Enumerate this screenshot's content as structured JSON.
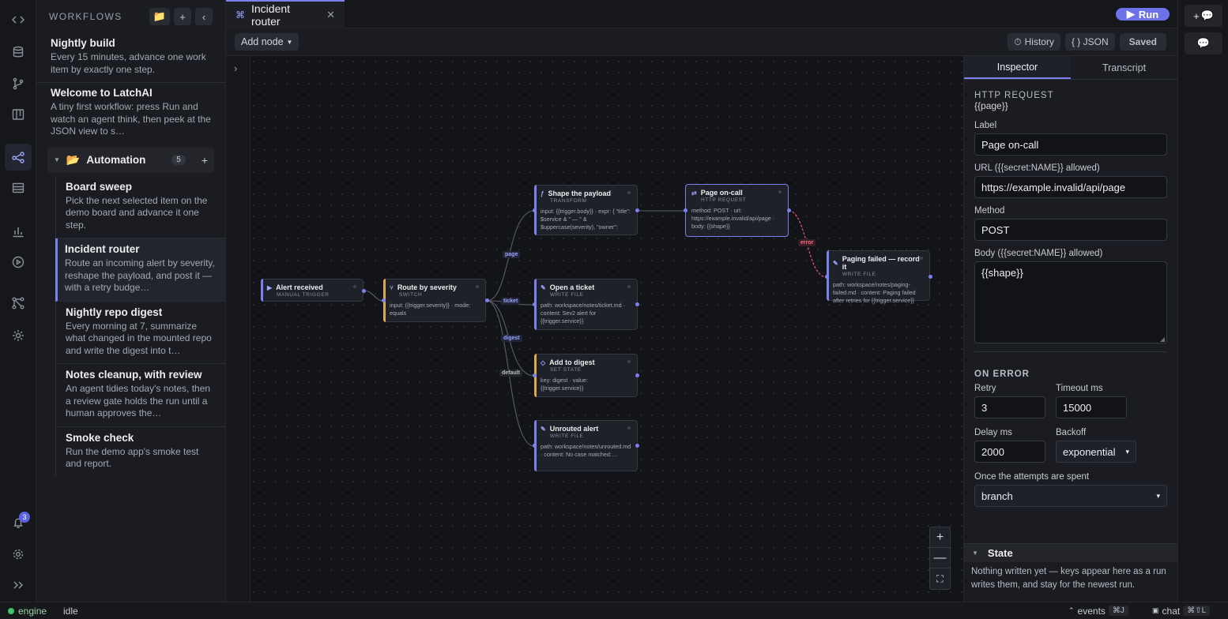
{
  "rail": {
    "items": [
      "code-icon",
      "database-icon",
      "branch-icon",
      "board-icon",
      "workflow-icon",
      "table-icon",
      "chart-icon",
      "play-icon",
      "graph-icon",
      "settings-cog-icon"
    ],
    "notifications_count": "3"
  },
  "sidebar": {
    "title": "WORKFLOWS",
    "workflows": [
      {
        "name": "Nightly build",
        "desc": "Every 15 minutes, advance one work item by exactly one step."
      },
      {
        "name": "Welcome to LatchAI",
        "desc": "A tiny first workflow: press Run and watch an agent think, then peek at the JSON view to s…"
      }
    ],
    "folder": {
      "name": "Automation",
      "count": "5",
      "items": [
        {
          "name": "Board sweep",
          "desc": "Pick the next selected item on the demo board and advance it one step."
        },
        {
          "name": "Incident router",
          "desc": "Route an incoming alert by severity, reshape the payload, and post it — with a retry budge…"
        },
        {
          "name": "Nightly repo digest",
          "desc": "Every morning at 7, summarize what changed in the mounted repo and write the digest into t…"
        },
        {
          "name": "Notes cleanup, with review",
          "desc": "An agent tidies today's notes, then a review gate holds the run until a human approves the…"
        },
        {
          "name": "Smoke check",
          "desc": "Run the demo app's smoke test and report."
        }
      ]
    }
  },
  "tab": {
    "label": "Incident router",
    "icon": "⌘"
  },
  "run_label": "Run",
  "toolbar": {
    "add_node": "Add node",
    "history": "History",
    "json": "{ } JSON",
    "saved": "Saved"
  },
  "nodes": {
    "alert": {
      "title": "Alert received",
      "kind": "MANUAL TRIGGER"
    },
    "route": {
      "title": "Route by severity",
      "kind": "SWITCH",
      "body": "input: {{trigger.severity}} · mode: equals"
    },
    "shape": {
      "title": "Shape the payload",
      "kind": "TRANSFORM",
      "body": "input: {{trigger.body}} · expr: { \"title\": $service & \" — \" & $uppercase(severity), \"owner\":"
    },
    "page": {
      "title": "Page on-call",
      "kind": "HTTP REQUEST",
      "body": "method: POST · url: https://example.invalid/api/page · body: {{shape}}"
    },
    "fail": {
      "title": "Paging failed — record it",
      "kind": "WRITE FILE",
      "body": "path: workspace/notes/paging-failed.md · content: Paging failed after retries for {{trigger.service}}"
    },
    "ticket": {
      "title": "Open a ticket",
      "kind": "WRITE FILE",
      "body": "path: workspace/notes/ticket.md · content: Sev2 alert for {{trigger.service}}"
    },
    "digest": {
      "title": "Add to digest",
      "kind": "SET STATE",
      "body": "key: digest · value: {{trigger.service}}"
    },
    "unrouted": {
      "title": "Unrouted alert",
      "kind": "WRITE FILE",
      "body": "path: workspace/notes/unrouted.md · content: No case matched:…"
    }
  },
  "edge_labels": {
    "page": "page",
    "ticket": "ticket",
    "digest": "digest",
    "default": "default",
    "error": "error"
  },
  "inspector": {
    "tabs": [
      "Inspector",
      "Transcript"
    ],
    "kind": "HTTP REQUEST",
    "sub": "{{page}}",
    "label_label": "Label",
    "label_value": "Page on-call",
    "url_label": "URL ({{secret:NAME}} allowed)",
    "url_value": "https://example.invalid/api/page",
    "method_label": "Method",
    "method_value": "POST",
    "body_label": "Body ({{secret:NAME}} allowed)",
    "body_value": "{{shape}}",
    "on_error": "ON ERROR",
    "retry_label": "Retry",
    "retry_value": "3",
    "timeout_label": "Timeout ms",
    "timeout_value": "15000",
    "delay_label": "Delay ms",
    "delay_value": "2000",
    "backoff_label": "Backoff",
    "backoff_value": "exponential",
    "spent_label": "Once the attempts are spent",
    "spent_value": "branch",
    "state_title": "State",
    "state_body": "Nothing written yet — keys appear here as a run writes them, and stay for the newest run."
  },
  "statusbar": {
    "engine": "engine",
    "state": "idle",
    "events": "events",
    "events_kbd": "⌘J",
    "chat": "chat",
    "chat_kbd": "⌘⇧L"
  }
}
